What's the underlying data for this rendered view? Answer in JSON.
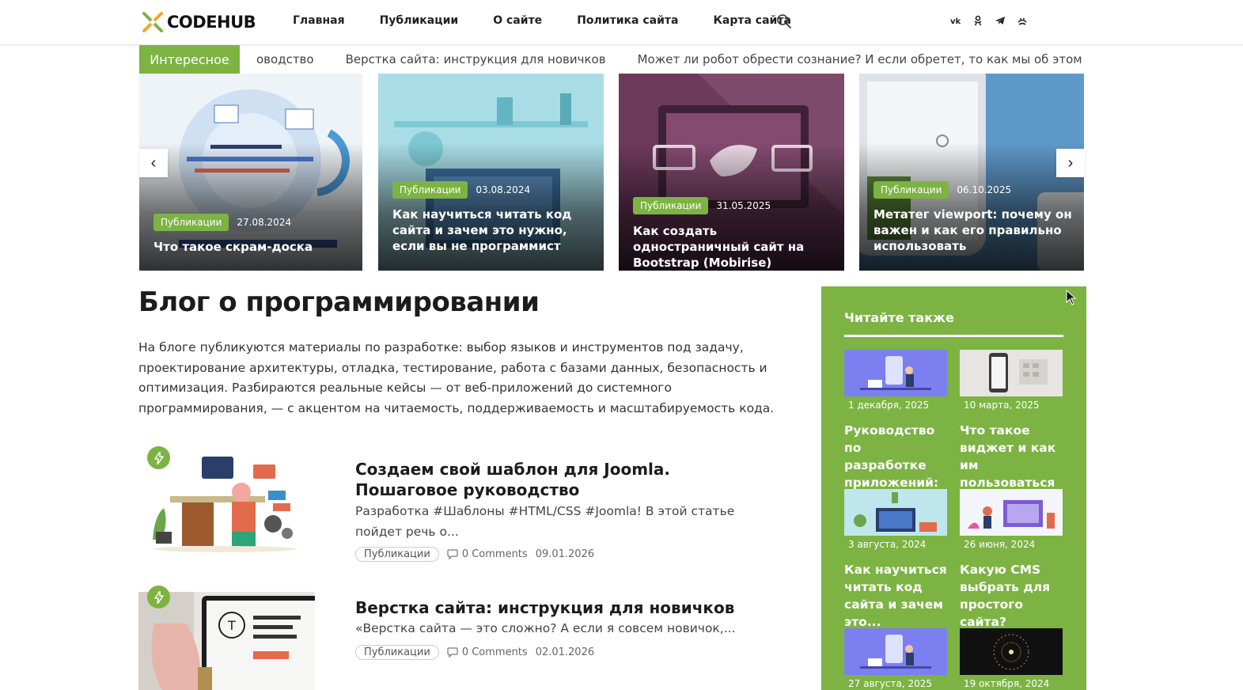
{
  "header": {
    "logo_text": "CODEHUB",
    "nav": [
      "Главная",
      "Публикации",
      "О сайте",
      "Политика сайта",
      "Карта сайта"
    ],
    "social_icons": [
      "vk-icon",
      "odnoklassniki-icon",
      "telegram-icon",
      "dzen-icon"
    ]
  },
  "ticker": {
    "label": "Интересное",
    "items": [
      "оводство",
      "Верстка сайта: инструкция для новичков",
      "Может ли робот обрести сознание? И если обретет, то как мы об этом узнаем?"
    ]
  },
  "slider": {
    "prev": "‹",
    "next": "›",
    "slides": [
      {
        "category": "Публикации",
        "date": "27.08.2024",
        "title": "Что такое скрам-доска"
      },
      {
        "category": "Публикации",
        "date": "03.08.2024",
        "title": "Как научиться читать код сайта и зачем это нужно, если вы не программист"
      },
      {
        "category": "Публикации",
        "date": "31.05.2025",
        "title": "Как создать одностраничный сайт на Bootstrap (Mobirise)"
      },
      {
        "category": "Публикации",
        "date": "06.10.2025",
        "title": "Метатег viewport: почему он важен и как его правильно использовать"
      }
    ]
  },
  "main": {
    "title": "Блог о программировании",
    "intro": "На блоге публикуются материалы по разработке: выбор языков и инструментов под задачу, проектирование архитектуры, отладка, тестирование, работа с базами данных, безопасность и оптимизация. Разбираются реальные кейсы — от веб-приложений до системного программирования, — с акцентом на читаемость, поддерживаемость и масштабируемость кода.",
    "posts": [
      {
        "title": "Создаем свой шаблон для Joomla. Пошаговое руководство",
        "excerpt": "Разработка #Шаблоны #HTML/CSS #Joomla! В этой статье пойдет речь о...",
        "category": "Публикации",
        "comments": "0 Comments",
        "date": "09.01.2026"
      },
      {
        "title": "Верстка сайта: инструкция для новичков",
        "excerpt": "«Верстка сайта — это сложно? А если я совсем новичок,...",
        "category": "Публикации",
        "comments": "0 Comments",
        "date": "02.01.2026"
      }
    ]
  },
  "sidebar": {
    "heading": "Читайте также",
    "cards": [
      {
        "date": "1 декабря, 2025",
        "title": "Руководство по разработке приложений: к..."
      },
      {
        "date": "10 марта, 2025",
        "title": "Что такое виджет и как им пользоваться"
      },
      {
        "date": "3 августа, 2024",
        "title": "Как научиться читать код сайта и зачем это..."
      },
      {
        "date": "26 июня, 2024",
        "title": "Какую CMS выбрать для простого сайта?"
      },
      {
        "date": "27 августа, 2025",
        "title": ""
      },
      {
        "date": "19 октября, 2024",
        "title": ""
      }
    ]
  },
  "colors": {
    "accent": "#7cb342",
    "text": "#1c1c1c"
  }
}
